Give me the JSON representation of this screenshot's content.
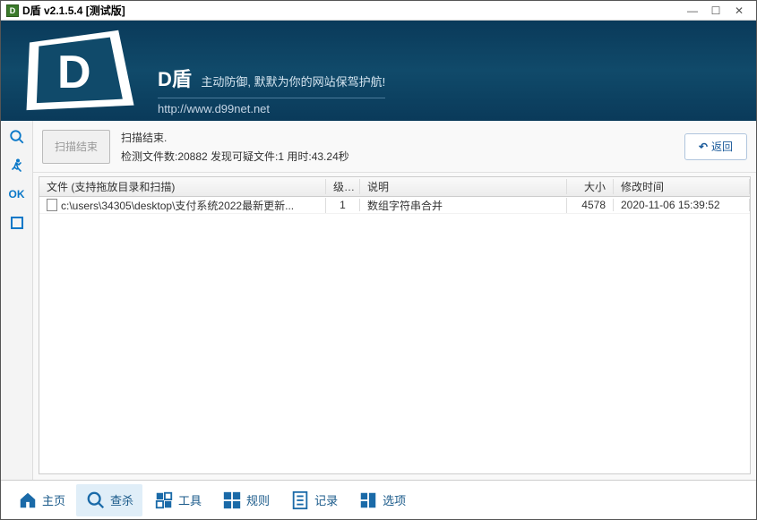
{
  "window": {
    "title": "D盾 v2.1.5.4 [测试版]",
    "icon_letter": "D"
  },
  "header": {
    "title": "D盾",
    "subtitle": "主动防御, 默默为你的网站保驾护航!",
    "url": "http://www.d99net.net"
  },
  "sidenav": {
    "ok_label": "OK"
  },
  "topbar": {
    "scan_button": "扫描结束",
    "status_line1": "扫描结束.",
    "status_line2": "检测文件数:20882 发现可疑文件:1 用时:43.24秒",
    "return_label": "返回"
  },
  "table": {
    "headers": {
      "file": "文件 (支持拖放目录和扫描)",
      "level": "级别",
      "desc": "说明",
      "size": "大小",
      "time": "修改时间"
    },
    "rows": [
      {
        "file": "c:\\users\\34305\\desktop\\支付系统2022最新更新...",
        "level": "1",
        "desc": "数组字符串合并",
        "size": "4578",
        "time": "2020-11-06 15:39:52"
      }
    ]
  },
  "bottomnav": {
    "home": "主页",
    "scan": "查杀",
    "tools": "工具",
    "rules": "规则",
    "records": "记录",
    "options": "选项"
  }
}
